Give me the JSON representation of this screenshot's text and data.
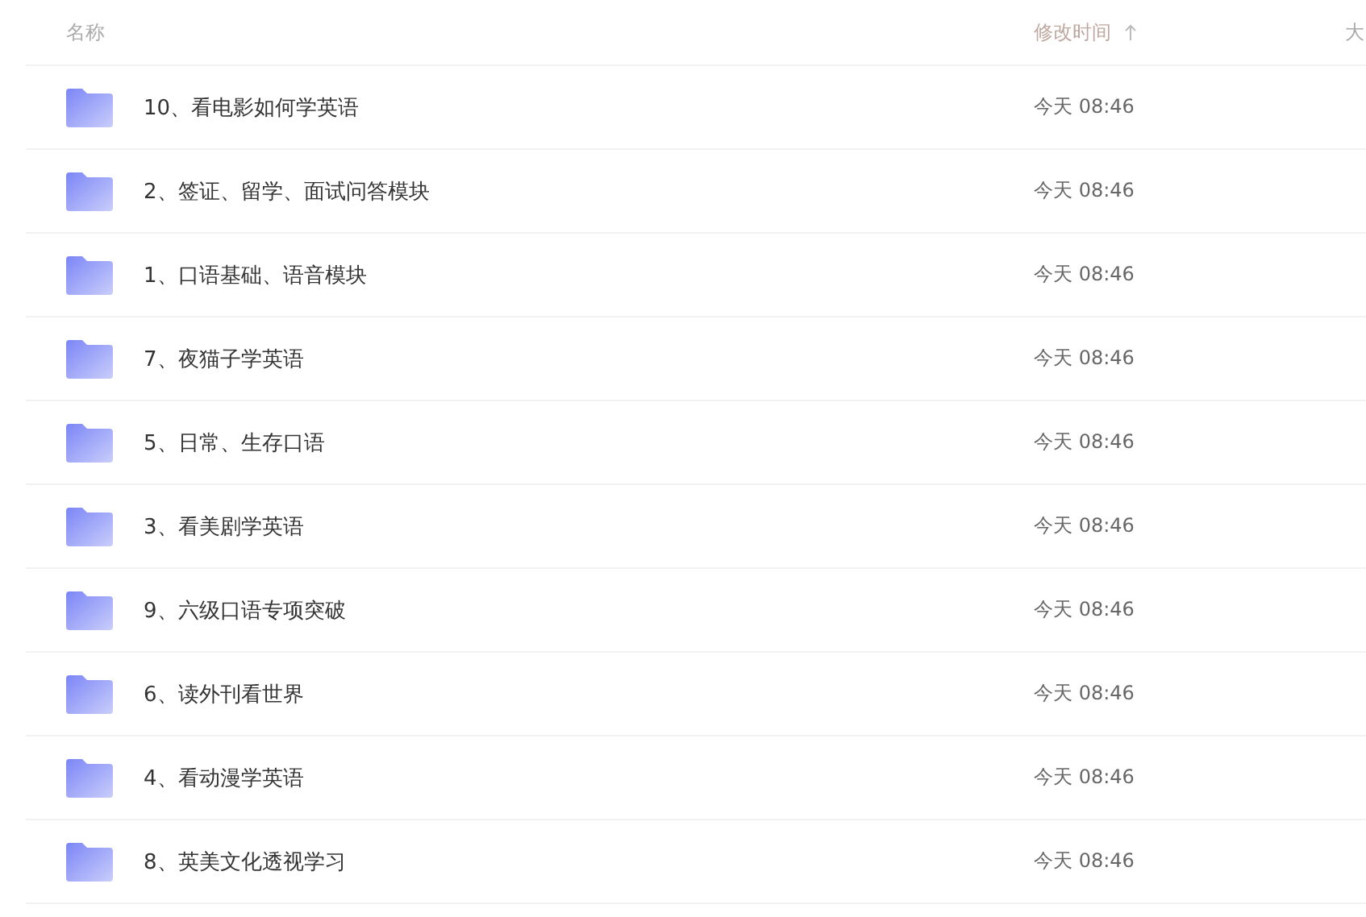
{
  "table": {
    "columns": [
      {
        "label": "名称",
        "sorted": false
      },
      {
        "label": "修改时间",
        "sorted": true
      },
      {
        "label": "大",
        "sorted": false
      }
    ],
    "rows": [
      {
        "name": "10、看电影如何学英语",
        "modified": "今天 08:46"
      },
      {
        "name": "2、签证、留学、面试问答模块",
        "modified": "今天 08:46"
      },
      {
        "name": "1、口语基础、语音模块",
        "modified": "今天 08:46"
      },
      {
        "name": "7、夜猫子学英语",
        "modified": "今天 08:46"
      },
      {
        "name": "5、日常、生存口语",
        "modified": "今天 08:46"
      },
      {
        "name": "3、看美剧学英语",
        "modified": "今天 08:46"
      },
      {
        "name": "9、六级口语专项突破",
        "modified": "今天 08:46"
      },
      {
        "name": "6、读外刊看世界",
        "modified": "今天 08:46"
      },
      {
        "name": "4、看动漫学英语",
        "modified": "今天 08:46"
      },
      {
        "name": "8、英美文化透视学习",
        "modified": "今天 08:46"
      }
    ]
  }
}
